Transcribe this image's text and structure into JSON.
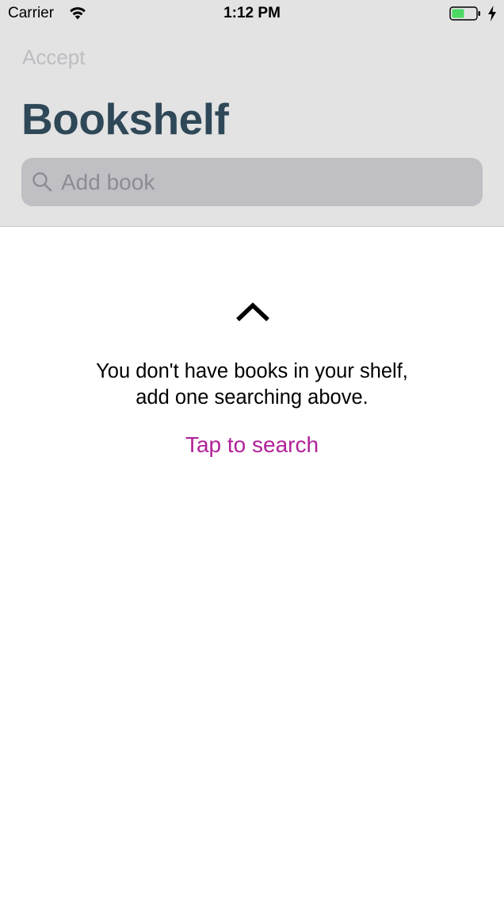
{
  "status_bar": {
    "carrier": "Carrier",
    "time": "1:12 PM",
    "battery_color": "#4cd964"
  },
  "nav": {
    "accept_label": "Accept",
    "title": "Bookshelf"
  },
  "search": {
    "placeholder": "Add book",
    "value": ""
  },
  "empty_state": {
    "icon": "chevron-up-icon",
    "message_line1": "You don't have books in your shelf,",
    "message_line2": "add one searching above.",
    "action_label": "Tap to search",
    "action_color": "#b1219a"
  },
  "colors": {
    "header_background": "#e3e3e3",
    "title": "#2f4858",
    "search_field": "#bfbfc4"
  }
}
